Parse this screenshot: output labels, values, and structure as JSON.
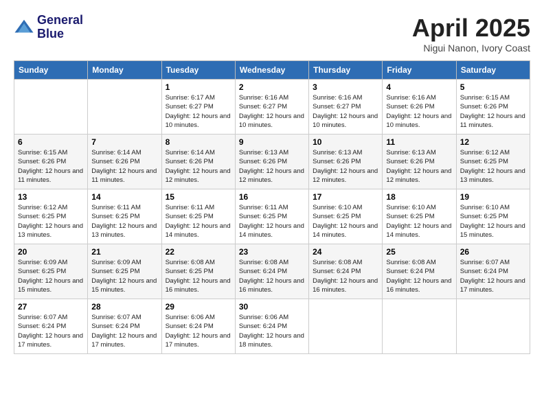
{
  "header": {
    "logo_line1": "General",
    "logo_line2": "Blue",
    "month_title": "April 2025",
    "location": "Nigui Nanon, Ivory Coast"
  },
  "weekdays": [
    "Sunday",
    "Monday",
    "Tuesday",
    "Wednesday",
    "Thursday",
    "Friday",
    "Saturday"
  ],
  "weeks": [
    [
      {
        "day": "",
        "sunrise": "",
        "sunset": "",
        "daylight": ""
      },
      {
        "day": "",
        "sunrise": "",
        "sunset": "",
        "daylight": ""
      },
      {
        "day": "1",
        "sunrise": "Sunrise: 6:17 AM",
        "sunset": "Sunset: 6:27 PM",
        "daylight": "Daylight: 12 hours and 10 minutes."
      },
      {
        "day": "2",
        "sunrise": "Sunrise: 6:16 AM",
        "sunset": "Sunset: 6:27 PM",
        "daylight": "Daylight: 12 hours and 10 minutes."
      },
      {
        "day": "3",
        "sunrise": "Sunrise: 6:16 AM",
        "sunset": "Sunset: 6:27 PM",
        "daylight": "Daylight: 12 hours and 10 minutes."
      },
      {
        "day": "4",
        "sunrise": "Sunrise: 6:16 AM",
        "sunset": "Sunset: 6:26 PM",
        "daylight": "Daylight: 12 hours and 10 minutes."
      },
      {
        "day": "5",
        "sunrise": "Sunrise: 6:15 AM",
        "sunset": "Sunset: 6:26 PM",
        "daylight": "Daylight: 12 hours and 11 minutes."
      }
    ],
    [
      {
        "day": "6",
        "sunrise": "Sunrise: 6:15 AM",
        "sunset": "Sunset: 6:26 PM",
        "daylight": "Daylight: 12 hours and 11 minutes."
      },
      {
        "day": "7",
        "sunrise": "Sunrise: 6:14 AM",
        "sunset": "Sunset: 6:26 PM",
        "daylight": "Daylight: 12 hours and 11 minutes."
      },
      {
        "day": "8",
        "sunrise": "Sunrise: 6:14 AM",
        "sunset": "Sunset: 6:26 PM",
        "daylight": "Daylight: 12 hours and 12 minutes."
      },
      {
        "day": "9",
        "sunrise": "Sunrise: 6:13 AM",
        "sunset": "Sunset: 6:26 PM",
        "daylight": "Daylight: 12 hours and 12 minutes."
      },
      {
        "day": "10",
        "sunrise": "Sunrise: 6:13 AM",
        "sunset": "Sunset: 6:26 PM",
        "daylight": "Daylight: 12 hours and 12 minutes."
      },
      {
        "day": "11",
        "sunrise": "Sunrise: 6:13 AM",
        "sunset": "Sunset: 6:26 PM",
        "daylight": "Daylight: 12 hours and 12 minutes."
      },
      {
        "day": "12",
        "sunrise": "Sunrise: 6:12 AM",
        "sunset": "Sunset: 6:25 PM",
        "daylight": "Daylight: 12 hours and 13 minutes."
      }
    ],
    [
      {
        "day": "13",
        "sunrise": "Sunrise: 6:12 AM",
        "sunset": "Sunset: 6:25 PM",
        "daylight": "Daylight: 12 hours and 13 minutes."
      },
      {
        "day": "14",
        "sunrise": "Sunrise: 6:11 AM",
        "sunset": "Sunset: 6:25 PM",
        "daylight": "Daylight: 12 hours and 13 minutes."
      },
      {
        "day": "15",
        "sunrise": "Sunrise: 6:11 AM",
        "sunset": "Sunset: 6:25 PM",
        "daylight": "Daylight: 12 hours and 14 minutes."
      },
      {
        "day": "16",
        "sunrise": "Sunrise: 6:11 AM",
        "sunset": "Sunset: 6:25 PM",
        "daylight": "Daylight: 12 hours and 14 minutes."
      },
      {
        "day": "17",
        "sunrise": "Sunrise: 6:10 AM",
        "sunset": "Sunset: 6:25 PM",
        "daylight": "Daylight: 12 hours and 14 minutes."
      },
      {
        "day": "18",
        "sunrise": "Sunrise: 6:10 AM",
        "sunset": "Sunset: 6:25 PM",
        "daylight": "Daylight: 12 hours and 14 minutes."
      },
      {
        "day": "19",
        "sunrise": "Sunrise: 6:10 AM",
        "sunset": "Sunset: 6:25 PM",
        "daylight": "Daylight: 12 hours and 15 minutes."
      }
    ],
    [
      {
        "day": "20",
        "sunrise": "Sunrise: 6:09 AM",
        "sunset": "Sunset: 6:25 PM",
        "daylight": "Daylight: 12 hours and 15 minutes."
      },
      {
        "day": "21",
        "sunrise": "Sunrise: 6:09 AM",
        "sunset": "Sunset: 6:25 PM",
        "daylight": "Daylight: 12 hours and 15 minutes."
      },
      {
        "day": "22",
        "sunrise": "Sunrise: 6:08 AM",
        "sunset": "Sunset: 6:25 PM",
        "daylight": "Daylight: 12 hours and 16 minutes."
      },
      {
        "day": "23",
        "sunrise": "Sunrise: 6:08 AM",
        "sunset": "Sunset: 6:24 PM",
        "daylight": "Daylight: 12 hours and 16 minutes."
      },
      {
        "day": "24",
        "sunrise": "Sunrise: 6:08 AM",
        "sunset": "Sunset: 6:24 PM",
        "daylight": "Daylight: 12 hours and 16 minutes."
      },
      {
        "day": "25",
        "sunrise": "Sunrise: 6:08 AM",
        "sunset": "Sunset: 6:24 PM",
        "daylight": "Daylight: 12 hours and 16 minutes."
      },
      {
        "day": "26",
        "sunrise": "Sunrise: 6:07 AM",
        "sunset": "Sunset: 6:24 PM",
        "daylight": "Daylight: 12 hours and 17 minutes."
      }
    ],
    [
      {
        "day": "27",
        "sunrise": "Sunrise: 6:07 AM",
        "sunset": "Sunset: 6:24 PM",
        "daylight": "Daylight: 12 hours and 17 minutes."
      },
      {
        "day": "28",
        "sunrise": "Sunrise: 6:07 AM",
        "sunset": "Sunset: 6:24 PM",
        "daylight": "Daylight: 12 hours and 17 minutes."
      },
      {
        "day": "29",
        "sunrise": "Sunrise: 6:06 AM",
        "sunset": "Sunset: 6:24 PM",
        "daylight": "Daylight: 12 hours and 17 minutes."
      },
      {
        "day": "30",
        "sunrise": "Sunrise: 6:06 AM",
        "sunset": "Sunset: 6:24 PM",
        "daylight": "Daylight: 12 hours and 18 minutes."
      },
      {
        "day": "",
        "sunrise": "",
        "sunset": "",
        "daylight": ""
      },
      {
        "day": "",
        "sunrise": "",
        "sunset": "",
        "daylight": ""
      },
      {
        "day": "",
        "sunrise": "",
        "sunset": "",
        "daylight": ""
      }
    ]
  ]
}
